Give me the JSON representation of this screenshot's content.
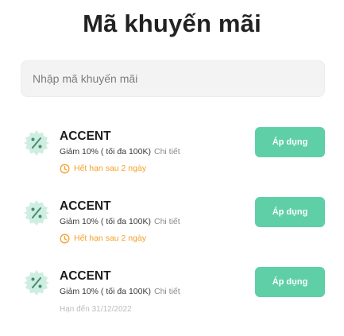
{
  "page": {
    "title": "Mã khuyến mãi"
  },
  "search": {
    "placeholder": "Nhập mã khuyến mãi",
    "value": ""
  },
  "colors": {
    "accent": "#5fcfa8",
    "warning": "#f5a02a",
    "badge": "#cdeee0"
  },
  "coupons": [
    {
      "code": "ACCENT",
      "description": "Giảm 10% ( tối đa 100K)",
      "detail_link": "Chi tiết",
      "expiry": "Hết hạn sau 2 ngày",
      "apply_label": "Áp dụng",
      "icon": "percent-badge-icon"
    },
    {
      "code": "ACCENT",
      "description": "Giảm 10% ( tối đa 100K)",
      "detail_link": "Chi tiết",
      "expiry": "Hết hạn sau 2 ngày",
      "apply_label": "Áp dụng",
      "icon": "percent-badge-icon"
    },
    {
      "code": "ACCENT",
      "description": "Giảm 10% ( tối đa 100K)",
      "detail_link": "Chi tiết",
      "valid_until": "Hạn đến 31/12/2022",
      "apply_label": "Áp dụng",
      "icon": "percent-badge-icon"
    }
  ]
}
